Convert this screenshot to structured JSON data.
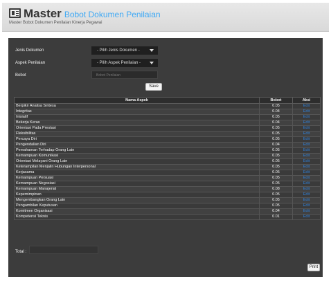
{
  "header": {
    "title": "Master",
    "subtitle": "Bobot Dokumen Penilaian",
    "caption": "Master Bobot Dokumen Penilaian Kinerja Pegawai"
  },
  "form": {
    "jenis_label": "Jenis Dokumen",
    "jenis_value": "- Pilih Jenis Dokumen -",
    "aspek_label": "Aspek Penilaian",
    "aspek_value": "- Pilih Aspek Penilaian -",
    "bobot_label": "Bobot",
    "bobot_placeholder": "Bobot Penilaian",
    "save_label": "Save"
  },
  "table": {
    "headers": [
      "Nama Aspek",
      "Bobot",
      "Aksi"
    ],
    "rows": [
      {
        "nama": "Berpikir Analisa Sintesa",
        "bobot": "0.05",
        "aksi": "Edit"
      },
      {
        "nama": "Integritas",
        "bobot": "0.04",
        "aksi": "Edit"
      },
      {
        "nama": "Inisiatif",
        "bobot": "0.05",
        "aksi": "Edit"
      },
      {
        "nama": "Bekerja Keras",
        "bobot": "0.04",
        "aksi": "Edit"
      },
      {
        "nama": "Orientasi Pada Prestasi",
        "bobot": "0.05",
        "aksi": "Edit"
      },
      {
        "nama": "Fleksibilitas",
        "bobot": "0.05",
        "aksi": "Edit"
      },
      {
        "nama": "Percaya Diri",
        "bobot": "0.05",
        "aksi": "Edit"
      },
      {
        "nama": "Pengendalian Diri",
        "bobot": "0.04",
        "aksi": "Edit"
      },
      {
        "nama": "Pemahaman Terhadap Orang Lain",
        "bobot": "0.05",
        "aksi": "Edit"
      },
      {
        "nama": "Kemampuan Komunikasi",
        "bobot": "0.05",
        "aksi": "Edit"
      },
      {
        "nama": "Orientasi Melayani Orang Lain",
        "bobot": "0.05",
        "aksi": "Edit"
      },
      {
        "nama": "Keterampilan Menjalin Hubungan Interpersonal",
        "bobot": "0.05",
        "aksi": "Edit"
      },
      {
        "nama": "Kerjasama",
        "bobot": "0.05",
        "aksi": "Edit"
      },
      {
        "nama": "Kemampuan Persuasi",
        "bobot": "0.05",
        "aksi": "Edit"
      },
      {
        "nama": "Kemampuan Negosiasi",
        "bobot": "0.05",
        "aksi": "Edit"
      },
      {
        "nama": "Kemampuan Manajerial",
        "bobot": "0.08",
        "aksi": "Edit"
      },
      {
        "nama": "Kepemimpinan",
        "bobot": "0.05",
        "aksi": "Edit"
      },
      {
        "nama": "Mengembangkan Orang Lain",
        "bobot": "0.05",
        "aksi": "Edit"
      },
      {
        "nama": "Pengambilan Keputusan",
        "bobot": "0.05",
        "aksi": "Edit"
      },
      {
        "nama": "Komitmen Organisasi",
        "bobot": "0.04",
        "aksi": "Edit"
      },
      {
        "nama": "Kompetensi Teknis",
        "bobot": "0.01",
        "aksi": "Edit"
      }
    ]
  },
  "footer": {
    "total_label": "Total :",
    "total_value": "",
    "print_label": "Print"
  },
  "icons": {
    "header_icon": "list-window-icon",
    "select_caret": "chevron-down-icon"
  },
  "colors": {
    "subtitle": "#3fa9f5",
    "panel_bg": "#3c3c3c",
    "edit_link": "#2f7fd6"
  }
}
